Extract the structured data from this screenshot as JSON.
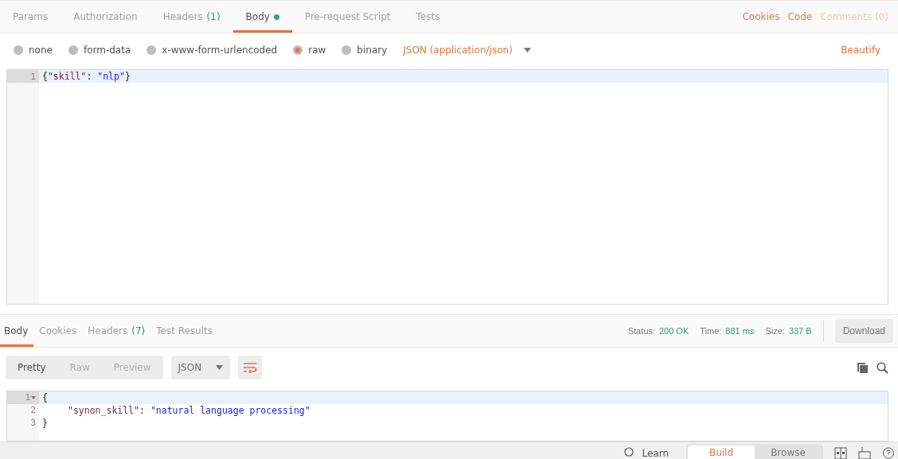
{
  "request_tabs": [
    {
      "label": "Params",
      "selected": false
    },
    {
      "label": "Authorization",
      "selected": false
    },
    {
      "label": "Headers",
      "count": "(1)",
      "selected": false
    },
    {
      "label": "Body",
      "dot": true,
      "selected": true
    },
    {
      "label": "Pre-request Script",
      "selected": false
    },
    {
      "label": "Tests",
      "selected": false
    }
  ],
  "request_links": [
    {
      "label": "Cookies",
      "disabled": false
    },
    {
      "label": "Code",
      "disabled": false
    },
    {
      "label": "Comments (0)",
      "disabled": true
    }
  ],
  "body_types": [
    {
      "label": "none",
      "selected": false
    },
    {
      "label": "form-data",
      "selected": false
    },
    {
      "label": "x-www-form-urlencoded",
      "selected": false
    },
    {
      "label": "raw",
      "selected": true
    },
    {
      "label": "binary",
      "selected": false
    }
  ],
  "content_type": "JSON (application/json)",
  "beautify": "Beautify",
  "request_editor": {
    "lines": [
      {
        "number": "1",
        "fold": false,
        "tokens": [
          {
            "kind": "punct",
            "text": "{"
          },
          {
            "kind": "key",
            "text": "\"skill\""
          },
          {
            "kind": "punct",
            "text": ": "
          },
          {
            "kind": "string",
            "text": "\"nlp\""
          },
          {
            "kind": "punct",
            "text": "}"
          }
        ]
      }
    ]
  },
  "response_tabs": [
    {
      "label": "Body",
      "selected": true
    },
    {
      "label": "Cookies",
      "selected": false
    },
    {
      "label": "Headers",
      "count": "(7)",
      "selected": false
    },
    {
      "label": "Test Results",
      "selected": false
    }
  ],
  "response_meta": [
    {
      "label": "Status:",
      "value": "200 OK"
    },
    {
      "label": "Time:",
      "value": "881 ms"
    },
    {
      "label": "Size:",
      "value": "337 B"
    }
  ],
  "download": "Download",
  "view_modes": [
    {
      "label": "Pretty",
      "selected": true
    },
    {
      "label": "Raw",
      "selected": false
    },
    {
      "label": "Preview",
      "selected": false
    }
  ],
  "format": "JSON",
  "response_editor": {
    "lines": [
      {
        "number": "1",
        "fold": true,
        "tokens": [
          {
            "kind": "punct",
            "text": "{"
          }
        ]
      },
      {
        "number": "2",
        "fold": false,
        "indent": true,
        "tokens": [
          {
            "kind": "key",
            "text": "\"synon_skill\""
          },
          {
            "kind": "punct",
            "text": ": "
          },
          {
            "kind": "string",
            "text": "\"natural language processing\""
          }
        ]
      },
      {
        "number": "3",
        "fold": false,
        "tokens": [
          {
            "kind": "punct",
            "text": "}"
          }
        ]
      }
    ]
  },
  "footer": {
    "learn": "Learn",
    "modes": [
      {
        "label": "Build",
        "selected": true
      },
      {
        "label": "Browse",
        "selected": false
      }
    ]
  }
}
